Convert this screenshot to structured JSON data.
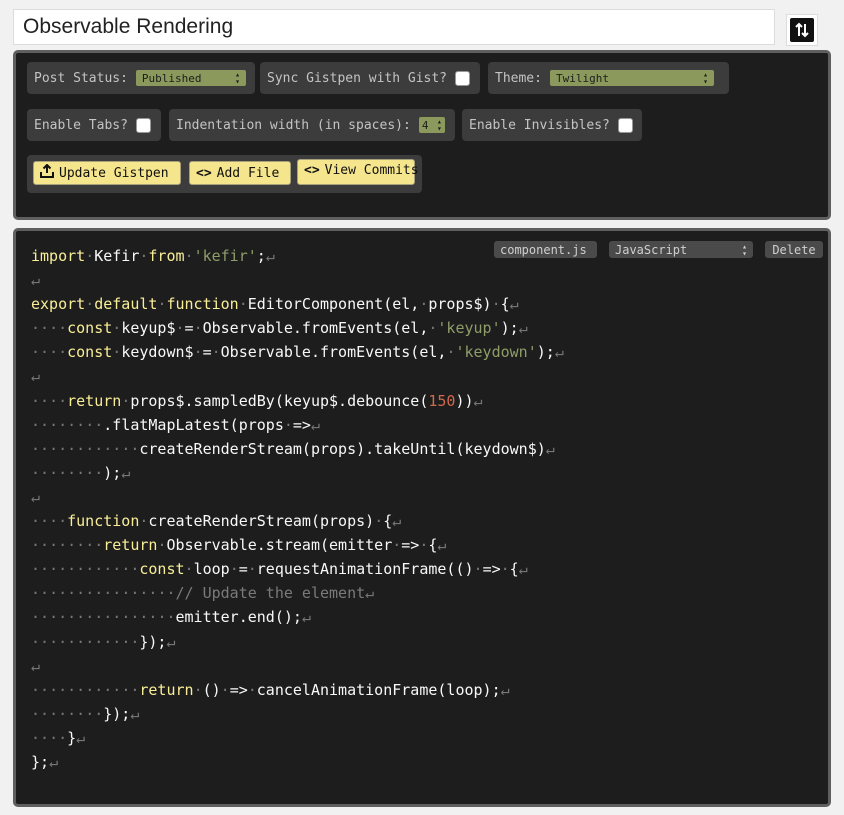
{
  "title": {
    "value": "Observable Rendering"
  },
  "toolbar": {
    "post_status": {
      "label": "Post Status:",
      "value": "Published"
    },
    "sync_gist": {
      "label": "Sync Gistpen with Gist?",
      "checked": false
    },
    "theme": {
      "label": "Theme:",
      "value": "Twilight"
    },
    "enable_tabs": {
      "label": "Enable Tabs?",
      "checked": false
    },
    "indentation": {
      "label": "Indentation width (in spaces):",
      "value": "4"
    },
    "enable_invisibles": {
      "label": "Enable Invisibles?",
      "checked": false
    },
    "update_label": "Update Gistpen",
    "add_file_label": "Add File",
    "view_commits_label": "View Commits"
  },
  "file": {
    "filename": "component.js",
    "language": "JavaScript",
    "delete_label": "Delete",
    "code_lines": [
      "import·Kefir·from·'kefir';",
      "",
      "export·default·function·EditorComponent(el,·props$)·{",
      "····const·keyup$·=·Observable.fromEvents(el,·'keyup');",
      "····const·keydown$·=·Observable.fromEvents(el,·'keydown');",
      "",
      "····return·props$.sampledBy(keyup$.debounce(150))",
      "········.flatMapLatest(props·=>",
      "············createRenderStream(props).takeUntil(keydown$)",
      "········);",
      "",
      "····function·createRenderStream(props)·{",
      "········return·Observable.stream(emitter·=>·{",
      "············const·loop·=·requestAnimationFrame(()·=>·{",
      "················// Update the element",
      "················emitter.end();",
      "············});",
      "",
      "············return·()·=>·cancelAnimationFrame(loop);",
      "········});",
      "····}",
      "};"
    ]
  },
  "colors": {
    "background": "#1d1d1d",
    "keyword": "#f9ee98",
    "string": "#8f9d6a",
    "number": "#cf6a4c",
    "comment": "#7a7a7a",
    "button": "#f5e58c"
  },
  "icons": {
    "toggle": "sort-arrows-icon",
    "update": "upload-icon",
    "add_file": "code-brackets-icon",
    "view_commits": "code-brackets-icon",
    "line_end": "pilcrow-return-icon"
  }
}
